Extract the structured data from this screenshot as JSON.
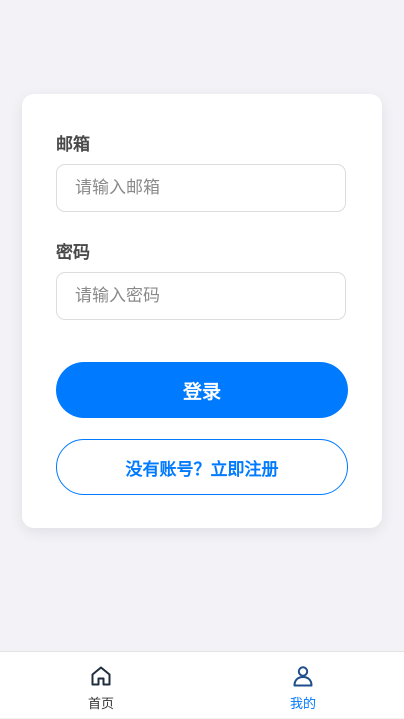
{
  "login_form": {
    "email_label": "邮箱",
    "email_placeholder": "请输入邮箱",
    "password_label": "密码",
    "password_placeholder": "请输入密码",
    "login_button": "登录",
    "register_button": "没有账号？立即注册"
  },
  "tabbar": {
    "items": [
      {
        "label": "首页",
        "icon": "home-icon",
        "active": false
      },
      {
        "label": "我的",
        "icon": "user-icon",
        "active": true
      }
    ]
  },
  "colors": {
    "accent": "#007aff",
    "background": "#f2f2f7",
    "inactive_tab": "#1f2d3d"
  }
}
